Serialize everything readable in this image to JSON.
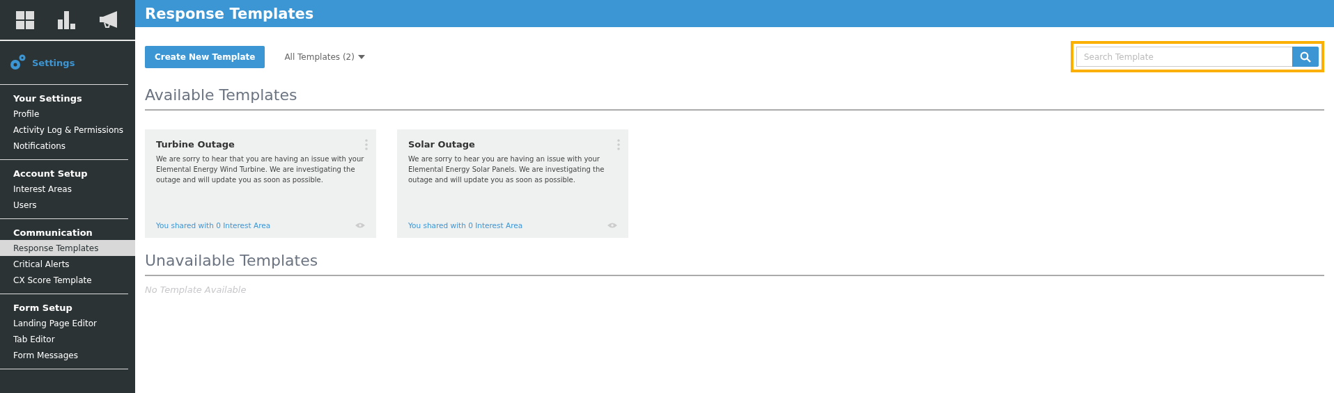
{
  "sidebar": {
    "settings_label": "Settings",
    "sections": [
      {
        "heading": "Your Settings",
        "items": [
          {
            "label": "Profile",
            "selected": false
          },
          {
            "label": "Activity Log & Permissions",
            "selected": false
          },
          {
            "label": "Notifications",
            "selected": false
          }
        ]
      },
      {
        "heading": "Account Setup",
        "items": [
          {
            "label": "Interest Areas",
            "selected": false
          },
          {
            "label": "Users",
            "selected": false
          }
        ]
      },
      {
        "heading": "Communication",
        "items": [
          {
            "label": "Response Templates",
            "selected": true
          },
          {
            "label": "Critical Alerts",
            "selected": false
          },
          {
            "label": "CX Score Template",
            "selected": false
          }
        ]
      },
      {
        "heading": "Form Setup",
        "items": [
          {
            "label": "Landing Page Editor",
            "selected": false
          },
          {
            "label": "Tab Editor",
            "selected": false
          },
          {
            "label": "Form Messages",
            "selected": false
          }
        ]
      }
    ]
  },
  "header": {
    "title": "Response Templates"
  },
  "toolbar": {
    "create_button": "Create New Template",
    "filter": "All Templates (2)",
    "search": {
      "placeholder": "Search Template"
    }
  },
  "available": {
    "title": "Available Templates",
    "cards": [
      {
        "title": "Turbine Outage",
        "body": "We are sorry to hear that you are having an issue with your Elemental Energy Wind Turbine. We are investigating the outage and will update you as soon as possible.",
        "shared": "You shared with 0 Interest Area"
      },
      {
        "title": "Solar Outage",
        "body": "We are sorry to hear you are having an issue with your Elemental Energy Solar Panels. We are investigating the outage and will update you as soon as possible.",
        "shared": "You shared with 0 Interest Area"
      }
    ]
  },
  "unavailable": {
    "title": "Unavailable Templates",
    "empty": "No Template Available"
  }
}
